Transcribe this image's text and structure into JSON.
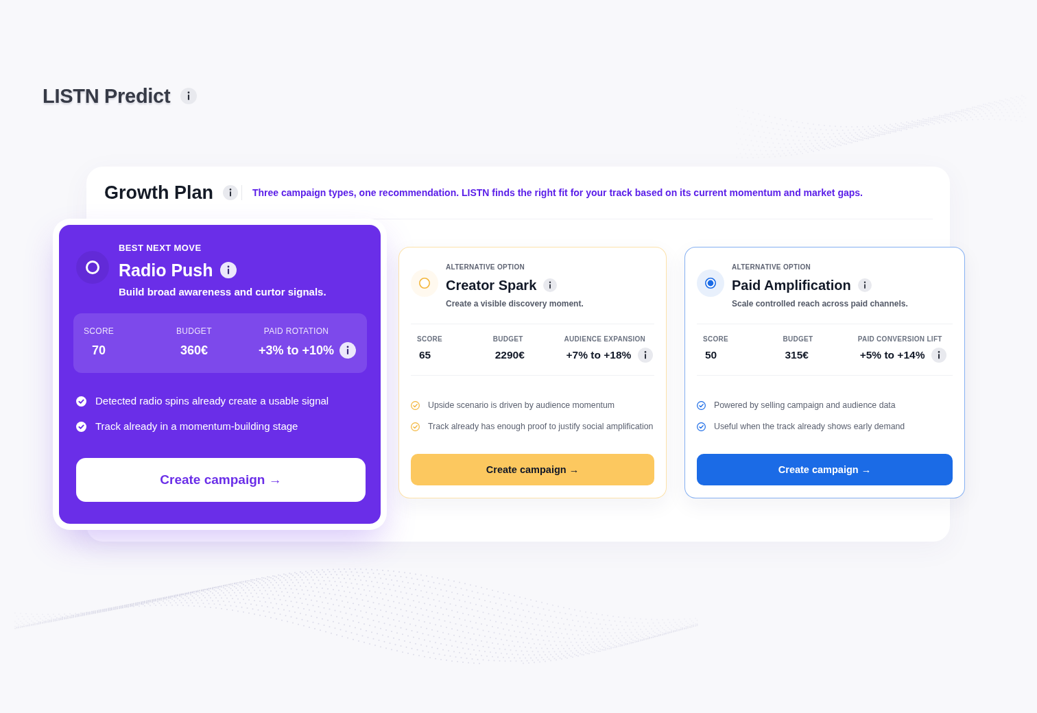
{
  "app": {
    "title": "LISTN Predict"
  },
  "panel": {
    "title": "Growth Plan",
    "description": "Three campaign types, one recommendation. LISTN finds the right fit for your track based on its current momentum and market gaps."
  },
  "cards": [
    {
      "kind": "featured",
      "color": "#6a2ee8",
      "selected": false,
      "eyebrow": "BEST NEXT MOVE",
      "title": "Radio Push",
      "description": "Build broad awareness and curtor signals.",
      "metrics": [
        {
          "label": "SCORE",
          "value": "70",
          "info": false
        },
        {
          "label": "BUDGET",
          "value": "360€",
          "info": false
        },
        {
          "label": "PAID ROTATION",
          "value": "+3% to +10%",
          "info": true
        }
      ],
      "bullets": [
        "Detected radio spins already create a usable signal",
        "Track already in a momentum-building stage"
      ],
      "button": "Create campaign →"
    },
    {
      "kind": "alternative",
      "color": "#fcc85f",
      "selected": false,
      "eyebrow": "ALTERNATIVE OPTION",
      "title": "Creator Spark",
      "description": "Create a visible discovery moment.",
      "metrics": [
        {
          "label": "SCORE",
          "value": "65",
          "info": false
        },
        {
          "label": "BUDGET",
          "value": "2290€",
          "info": false
        },
        {
          "label": "AUDIENCE EXPANSION",
          "value": "+7% to +18%",
          "info": true
        }
      ],
      "bullets": [
        "Upside scenario is driven by audience momentum",
        "Track already has enough proof to justify social amplification"
      ],
      "button": "Create campaign →"
    },
    {
      "kind": "alternative",
      "color": "#1b6be6",
      "selected": true,
      "eyebrow": "ALTERNATIVE OPTION",
      "title": "Paid Amplification",
      "description": "Scale controlled reach across paid channels.",
      "metrics": [
        {
          "label": "SCORE",
          "value": "50",
          "info": false
        },
        {
          "label": "BUDGET",
          "value": "315€",
          "info": false
        },
        {
          "label": "PAID CONVERSION LIFT",
          "value": "+5% to +14%",
          "info": true
        }
      ],
      "bullets": [
        "Powered by selling campaign and audience data",
        "Useful when the track already shows early demand"
      ],
      "button": "Create campaign →"
    }
  ]
}
